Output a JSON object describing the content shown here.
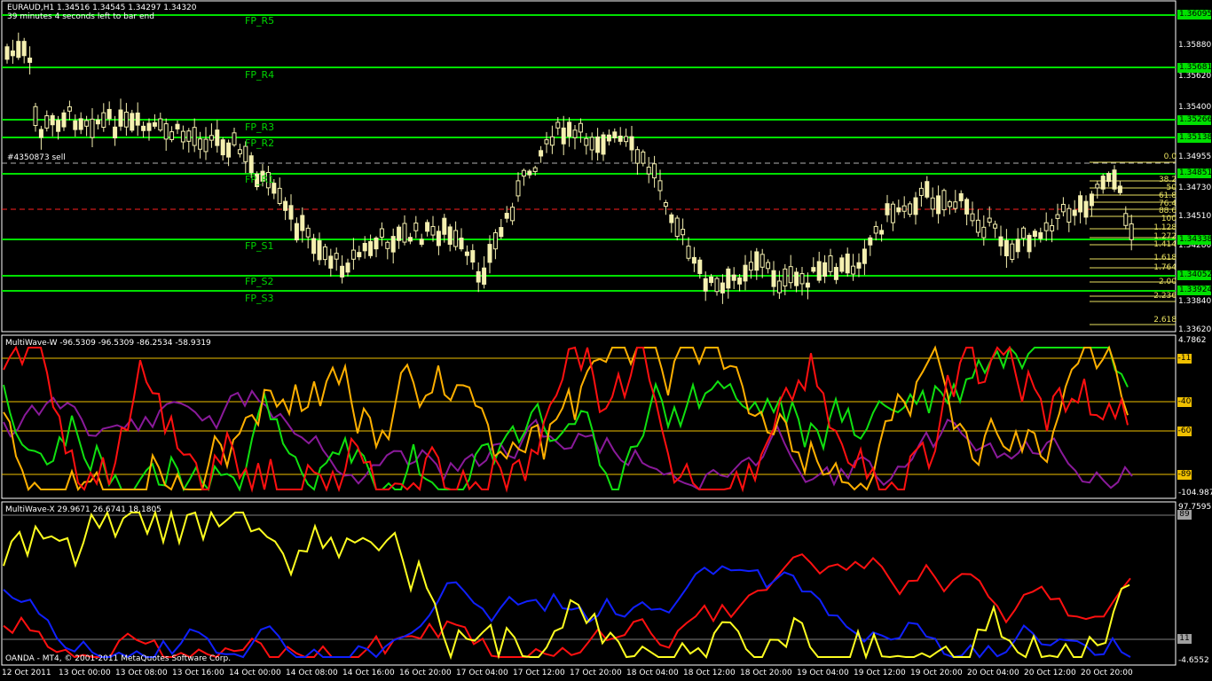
{
  "header": {
    "symbol_line": "EURAUD,H1  1.34516 1.34545 1.34297 1.34320",
    "timer": "39 minutes 4 seconds left to bar end",
    "order_label": "#4350873 sell"
  },
  "price_axis": [
    "1.36095",
    "1.35880",
    "1.35620",
    "1.35400",
    "1.35138",
    "1.34955",
    "1.34730",
    "1.34510",
    "1.34280",
    "1.33840",
    "1.33620"
  ],
  "pivot_labels": [
    "FP_R5",
    "FP_R4",
    "FP_R3",
    "FP_R2",
    "FP_R1",
    "FP_S1",
    "FP_S2",
    "FP_S3"
  ],
  "price_tags": [
    "1.36095",
    "1.35681",
    "1.35266",
    "1.35138",
    "1.34851",
    "1.34338",
    "1.34052",
    "1.33924"
  ],
  "fib_levels": [
    "0.0",
    "38.2",
    "50",
    "61.8",
    "76.4",
    "88.6",
    "100",
    "1.128",
    "1.272",
    "1.414",
    "1.618",
    "1.764",
    "2.00",
    "2.236",
    "2.618"
  ],
  "indicator_w": {
    "caption": "MultiWave-W -96.5309 -96.5309 -86.2534 -58.9319",
    "axis_top": "4.7862",
    "axis_bottom": "-104.987",
    "levels": [
      "-11",
      "-40",
      "-60",
      "-89"
    ]
  },
  "indicator_x": {
    "caption": "MultiWave-X 29.9671 26.6741 18.1805",
    "axis_top": "97.7595",
    "axis_bottom": "-4.6552",
    "levels": [
      "89",
      "11"
    ]
  },
  "footer": {
    "copyright": "OANDA - MT4, © 2001-2011 MetaQuotes Software Corp."
  },
  "time_axis": [
    "12 Oct 2011",
    "13 Oct 00:00",
    "13 Oct 08:00",
    "13 Oct 16:00",
    "14 Oct 00:00",
    "14 Oct 08:00",
    "14 Oct 16:00",
    "16 Oct 20:00",
    "17 Oct 04:00",
    "17 Oct 12:00",
    "17 Oct 20:00",
    "18 Oct 04:00",
    "18 Oct 12:00",
    "18 Oct 20:00",
    "19 Oct 04:00",
    "19 Oct 12:00",
    "19 Oct 20:00",
    "20 Oct 04:00",
    "20 Oct 12:00",
    "20 Oct 20:00"
  ],
  "colors": {
    "pivot": "#00e000",
    "candle": "#f5f0b0",
    "fib": "#e8e060",
    "w_red": "#ff1010",
    "w_orange": "#ffb000",
    "w_green": "#10e010",
    "w_purple": "#8a1a9a",
    "x_yellow": "#ffff20",
    "x_blue": "#1020ff",
    "x_red": "#ff1010"
  }
}
